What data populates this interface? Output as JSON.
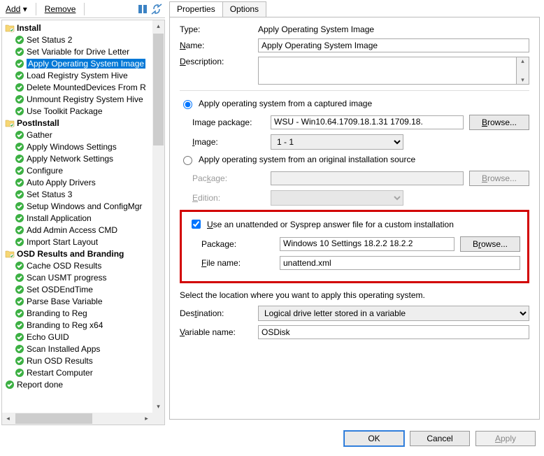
{
  "toolbar": {
    "add": "Add",
    "remove": "Remove"
  },
  "tree": {
    "groups": [
      {
        "label": "Install",
        "items": [
          "Set Status 2",
          "Set Variable for Drive Letter",
          "Apply Operating System Image",
          "Load Registry System Hive",
          "Delete MountedDevices From R",
          "Unmount Registry System Hive",
          "Use Toolkit Package"
        ],
        "selected_index": 2
      },
      {
        "label": "PostInstall",
        "items": [
          "Gather",
          "Apply Windows Settings",
          "Apply Network Settings",
          "Configure",
          "Auto Apply Drivers",
          "Set Status 3",
          "Setup Windows and ConfigMgr",
          "Install Application",
          "Add Admin Access CMD",
          "Import Start Layout"
        ]
      },
      {
        "label": "OSD Results and Branding",
        "items": [
          "Cache OSD Results",
          "Scan USMT progress",
          "Set OSDEndTime",
          "Parse Base Variable",
          "Branding to Reg",
          "Branding to Reg x64",
          "Echo GUID",
          "Scan Installed Apps",
          "Run OSD Results",
          "Restart Computer"
        ]
      }
    ],
    "final_item": "Report done"
  },
  "tabs": {
    "properties": "Properties",
    "options": "Options"
  },
  "props": {
    "type_label": "Type:",
    "type_value": "Apply Operating System Image",
    "name_label_pre": "N",
    "name_label_post": "ame:",
    "name_value": "Apply Operating System Image",
    "desc_label_pre": "D",
    "desc_label_post": "escription:",
    "desc_value": "",
    "apply_captured": "Apply operating system from a captured image",
    "image_package_label_pre": "Image packa",
    "image_package_label_mid": "g",
    "image_package_label_post": "e:",
    "image_package_value": "WSU - Win10.64.1709.18.1.31 1709.18.",
    "browse1": "Browse...",
    "image_label_pre": "I",
    "image_label_post": "mage:",
    "image_value": "1 - 1",
    "apply_original": "Apply operating system from an original installation source",
    "package_label_pre": "Pac",
    "package_label_mid": "k",
    "package_label_post": "age:",
    "browse2": "Browse...",
    "edition_label_pre": "E",
    "edition_label_post": "dition:",
    "use_unattend_pre": "U",
    "use_unattend_post": "se an unattended or Sysprep answer file for a custom installation",
    "package2_label": "Package:",
    "package2_value": "Windows 10 Settings 18.2.2 18.2.2",
    "browse3": "Browse...",
    "filename_label_pre": "F",
    "filename_label_post": "ile name:",
    "filename_value": "unattend.xml",
    "dest_intro": "Select the location where you want to apply this operating system.",
    "dest_label_pre": "Des",
    "dest_label_mid": "t",
    "dest_label_post": "ination:",
    "dest_value": "Logical drive letter stored in a variable",
    "var_label_pre": "V",
    "var_label_post": "ariable name:",
    "var_value": "OSDisk"
  },
  "buttons": {
    "ok": "OK",
    "cancel": "Cancel",
    "apply": "Apply"
  }
}
